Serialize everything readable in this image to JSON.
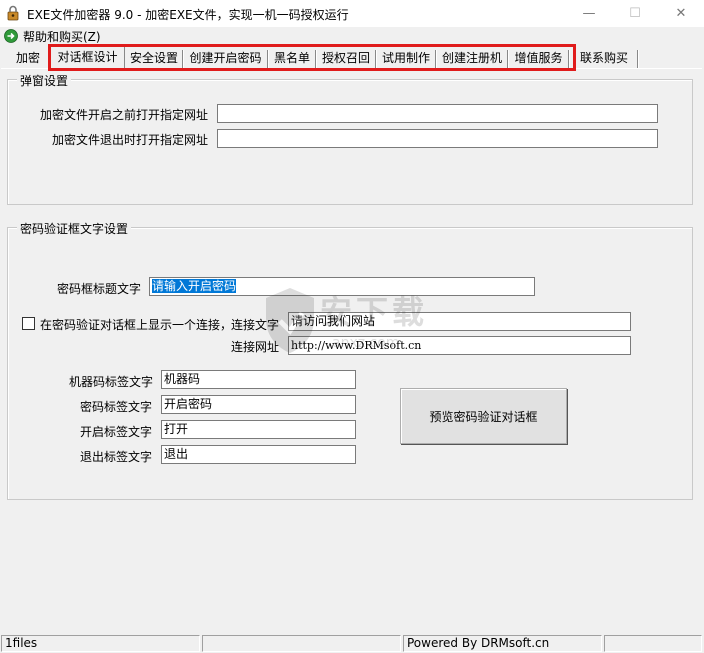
{
  "window": {
    "title": "EXE文件加密器 9.0 - 加密EXE文件，实现一机一码授权运行",
    "minimize": "—",
    "maximize": "☐",
    "close": "✕"
  },
  "menu": {
    "help_buy": "帮助和购买(Z)"
  },
  "tabs": [
    {
      "label": "加密"
    },
    {
      "label": "对话框设计"
    },
    {
      "label": "安全设置"
    },
    {
      "label": "创建开启密码"
    },
    {
      "label": "黑名单"
    },
    {
      "label": "授权召回"
    },
    {
      "label": "试用制作"
    },
    {
      "label": "创建注册机"
    },
    {
      "label": "增值服务"
    },
    {
      "label": "联系购买"
    }
  ],
  "popup_group": {
    "title": "弹窗设置",
    "open_url_label": "加密文件开启之前打开指定网址",
    "open_url_value": "",
    "exit_url_label": "加密文件退出时打开指定网址",
    "exit_url_value": ""
  },
  "password_group": {
    "title": "密码验证框文字设置",
    "dialog_title_label": "密码框标题文字",
    "dialog_title_value": "请输入开启密码",
    "show_link_label": "在密码验证对话框上显示一个连接，",
    "link_text_label": "连接文字",
    "link_text_value": "请访问我们网站",
    "link_url_label": "连接网址",
    "link_url_value": "http://www.DRMsoft.cn",
    "machine_code_label": "机器码标签文字",
    "machine_code_value": "机器码",
    "password_label": "密码标签文字",
    "password_value": "开启密码",
    "open_label": "开启标签文字",
    "open_value": "打开",
    "exit_label": "退出标签文字",
    "exit_value": "退出",
    "preview_button": "预览密码验证对话框"
  },
  "watermark": {
    "text": "安下载",
    "url": "anxz.com"
  },
  "status": {
    "files": "1files",
    "middle": "",
    "powered": "Powered By DRMsoft.cn",
    "end": ""
  },
  "colors": {
    "highlight_border": "#e01b1b",
    "selection": "#0078d7"
  }
}
